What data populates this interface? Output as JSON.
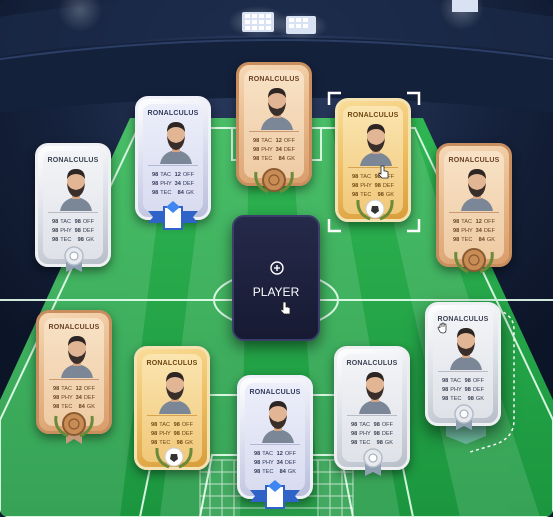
{
  "theme": {
    "sky_color": "#0f1a30",
    "pitch_light": "#34c15a",
    "pitch_dark": "#1f9e45",
    "line_color": "#e9fff0"
  },
  "add_slot": {
    "label": "PLAYER",
    "icon": "plus-circle-icon"
  },
  "cards": [
    {
      "id": "card-left-top",
      "style": "silver",
      "name": "RONALCULUS",
      "stats": [
        [
          "98",
          "TAC",
          "98",
          "OFF"
        ],
        [
          "98",
          "PHY",
          "98",
          "DEF"
        ],
        [
          "98",
          "TEC",
          "98",
          "GK"
        ]
      ],
      "emblem": "silver-badge-icon"
    },
    {
      "id": "card-left-mid-top",
      "style": "lavender",
      "name": "RONALCULUS",
      "stats": [
        [
          "98",
          "TAC",
          "12",
          "OFF"
        ],
        [
          "98",
          "PHY",
          "34",
          "DEF"
        ],
        [
          "98",
          "TEC",
          "84",
          "GK"
        ]
      ],
      "emblem": "blue-ribbon-icon"
    },
    {
      "id": "card-top-center",
      "style": "wood",
      "name": "RONALCULUS",
      "stats": [
        [
          "98",
          "TAC",
          "12",
          "OFF"
        ],
        [
          "98",
          "PHY",
          "34",
          "DEF"
        ],
        [
          "98",
          "TEC",
          "84",
          "GK"
        ]
      ],
      "emblem": "wood-laurel-icon"
    },
    {
      "id": "card-right-mid-top",
      "style": "gold",
      "name": "RONALCULUS",
      "stats": [
        [
          "98",
          "TAC",
          "98",
          "OFF"
        ],
        [
          "98",
          "PHY",
          "98",
          "DEF"
        ],
        [
          "98",
          "TEC",
          "98",
          "GK"
        ]
      ],
      "emblem": "ball-laurel-icon",
      "selected": true
    },
    {
      "id": "card-right-top",
      "style": "wood",
      "name": "RONALCULUS",
      "stats": [
        [
          "98",
          "TAC",
          "12",
          "OFF"
        ],
        [
          "98",
          "PHY",
          "34",
          "DEF"
        ],
        [
          "98",
          "TEC",
          "84",
          "GK"
        ]
      ],
      "emblem": "wood-laurel-icon"
    },
    {
      "id": "card-left-bottom",
      "style": "wood",
      "name": "RONALCULUS",
      "stats": [
        [
          "98",
          "TAC",
          "12",
          "OFF"
        ],
        [
          "98",
          "PHY",
          "34",
          "DEF"
        ],
        [
          "98",
          "TEC",
          "84",
          "GK"
        ]
      ],
      "emblem": "wood-laurel-icon"
    },
    {
      "id": "card-left-mid-bottom",
      "style": "gold",
      "name": "RONALCULUS",
      "stats": [
        [
          "98",
          "TAC",
          "98",
          "OFF"
        ],
        [
          "98",
          "PHY",
          "98",
          "DEF"
        ],
        [
          "98",
          "TEC",
          "98",
          "GK"
        ]
      ],
      "emblem": "ball-laurel-icon"
    },
    {
      "id": "card-bottom-center",
      "style": "lavender",
      "name": "RONALCULUS",
      "stats": [
        [
          "98",
          "TAC",
          "12",
          "OFF"
        ],
        [
          "98",
          "PHY",
          "34",
          "DEF"
        ],
        [
          "98",
          "TEC",
          "84",
          "GK"
        ]
      ],
      "emblem": "blue-ribbon-icon"
    },
    {
      "id": "card-right-mid-bottom",
      "style": "silver",
      "name": "RONALCULUS",
      "stats": [
        [
          "98",
          "TAC",
          "98",
          "OFF"
        ],
        [
          "98",
          "PHY",
          "98",
          "DEF"
        ],
        [
          "98",
          "TEC",
          "98",
          "GK"
        ]
      ],
      "emblem": "silver-badge-icon"
    },
    {
      "id": "card-right-bottom",
      "style": "silver",
      "name": "RONALCULUS",
      "stats": [
        [
          "98",
          "TAC",
          "98",
          "OFF"
        ],
        [
          "98",
          "PHY",
          "98",
          "DEF"
        ],
        [
          "98",
          "TEC",
          "98",
          "GK"
        ]
      ],
      "emblem": "silver-badge-icon",
      "dragging": true
    }
  ]
}
